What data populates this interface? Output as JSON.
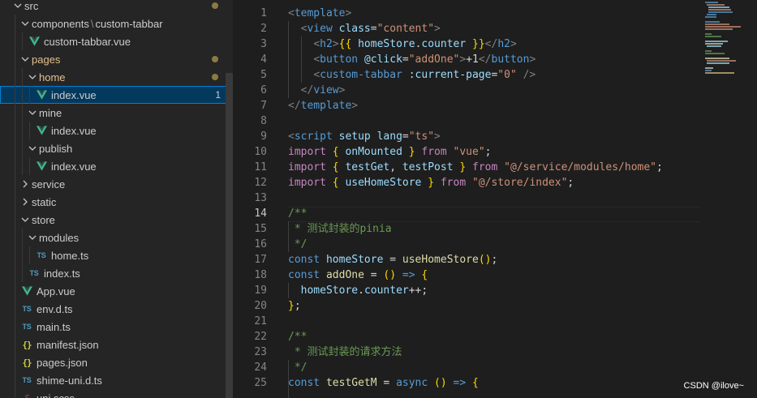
{
  "explorer": {
    "items": [
      {
        "label": "src",
        "type": "folder",
        "open": true,
        "depth": 0,
        "partial": true
      },
      {
        "label": "components",
        "label2": "custom-tabbar",
        "type": "folder",
        "open": true,
        "depth": 1
      },
      {
        "label": "custom-tabbar.vue",
        "type": "vue",
        "depth": 2
      },
      {
        "label": "pages",
        "type": "folder",
        "open": true,
        "depth": 1,
        "modified": true
      },
      {
        "label": "home",
        "type": "folder",
        "open": true,
        "depth": 2,
        "modified": true
      },
      {
        "label": "index.vue",
        "type": "vue",
        "depth": 3,
        "selected": true,
        "badge": "1"
      },
      {
        "label": "mine",
        "type": "folder",
        "open": true,
        "depth": 2
      },
      {
        "label": "index.vue",
        "type": "vue",
        "depth": 3
      },
      {
        "label": "publish",
        "type": "folder",
        "open": true,
        "depth": 2
      },
      {
        "label": "index.vue",
        "type": "vue",
        "depth": 3
      },
      {
        "label": "service",
        "type": "folder",
        "open": false,
        "depth": 1
      },
      {
        "label": "static",
        "type": "folder",
        "open": false,
        "depth": 1
      },
      {
        "label": "store",
        "type": "folder",
        "open": true,
        "depth": 1
      },
      {
        "label": "modules",
        "type": "folder",
        "open": true,
        "depth": 2
      },
      {
        "label": "home.ts",
        "type": "ts",
        "depth": 3
      },
      {
        "label": "index.ts",
        "type": "ts",
        "depth": 2
      },
      {
        "label": "App.vue",
        "type": "vue",
        "depth": 1
      },
      {
        "label": "env.d.ts",
        "type": "ts",
        "depth": 1
      },
      {
        "label": "main.ts",
        "type": "ts",
        "depth": 1
      },
      {
        "label": "manifest.json",
        "type": "json",
        "depth": 1
      },
      {
        "label": "pages.json",
        "type": "json",
        "depth": 1
      },
      {
        "label": "shime-uni.d.ts",
        "type": "ts",
        "depth": 1
      },
      {
        "label": "uni.scss",
        "type": "css",
        "depth": 1
      }
    ]
  },
  "editor": {
    "active_line": 14,
    "lines": [
      {
        "n": 1,
        "tokens": [
          [
            "t-punc",
            "<"
          ],
          [
            "t-tag",
            "template"
          ],
          [
            "t-punc",
            ">"
          ]
        ]
      },
      {
        "n": 2,
        "tokens": [
          [
            "t-text",
            "  "
          ],
          [
            "t-punc",
            "<"
          ],
          [
            "t-tag",
            "view"
          ],
          [
            "t-text",
            " "
          ],
          [
            "t-attr",
            "class"
          ],
          [
            "t-text",
            "="
          ],
          [
            "t-str",
            "\"content\""
          ],
          [
            "t-punc",
            ">"
          ]
        ]
      },
      {
        "n": 3,
        "tokens": [
          [
            "t-text",
            "    "
          ],
          [
            "t-punc",
            "<"
          ],
          [
            "t-tag",
            "h2"
          ],
          [
            "t-punc",
            ">"
          ],
          [
            "t-brace",
            "{{"
          ],
          [
            "t-text",
            " "
          ],
          [
            "t-var",
            "homeStore"
          ],
          [
            "t-text",
            "."
          ],
          [
            "t-var",
            "counter"
          ],
          [
            "t-text",
            " "
          ],
          [
            "t-brace",
            "}}"
          ],
          [
            "t-punc",
            "</"
          ],
          [
            "t-tag",
            "h2"
          ],
          [
            "t-punc",
            ">"
          ]
        ]
      },
      {
        "n": 4,
        "tokens": [
          [
            "t-text",
            "    "
          ],
          [
            "t-punc",
            "<"
          ],
          [
            "t-tag",
            "button"
          ],
          [
            "t-text",
            " "
          ],
          [
            "t-attr",
            "@click"
          ],
          [
            "t-text",
            "="
          ],
          [
            "t-str",
            "\"addOne\""
          ],
          [
            "t-punc",
            ">"
          ],
          [
            "t-text",
            "+1"
          ],
          [
            "t-punc",
            "</"
          ],
          [
            "t-tag",
            "button"
          ],
          [
            "t-punc",
            ">"
          ]
        ]
      },
      {
        "n": 5,
        "tokens": [
          [
            "t-text",
            "    "
          ],
          [
            "t-punc",
            "<"
          ],
          [
            "t-tag",
            "custom-tabbar"
          ],
          [
            "t-text",
            " "
          ],
          [
            "t-attr",
            ":current-page"
          ],
          [
            "t-text",
            "="
          ],
          [
            "t-str",
            "\"0\""
          ],
          [
            "t-text",
            " "
          ],
          [
            "t-punc",
            "/>"
          ]
        ]
      },
      {
        "n": 6,
        "tokens": [
          [
            "t-text",
            "  "
          ],
          [
            "t-punc",
            "</"
          ],
          [
            "t-tag",
            "view"
          ],
          [
            "t-punc",
            ">"
          ]
        ]
      },
      {
        "n": 7,
        "tokens": [
          [
            "t-punc",
            "</"
          ],
          [
            "t-tag",
            "template"
          ],
          [
            "t-punc",
            ">"
          ]
        ]
      },
      {
        "n": 8,
        "tokens": []
      },
      {
        "n": 9,
        "tokens": [
          [
            "t-punc",
            "<"
          ],
          [
            "t-tag",
            "script"
          ],
          [
            "t-text",
            " "
          ],
          [
            "t-attr",
            "setup"
          ],
          [
            "t-text",
            " "
          ],
          [
            "t-attr",
            "lang"
          ],
          [
            "t-text",
            "="
          ],
          [
            "t-str",
            "\"ts\""
          ],
          [
            "t-punc",
            ">"
          ]
        ]
      },
      {
        "n": 10,
        "tokens": [
          [
            "t-imp",
            "import"
          ],
          [
            "t-text",
            " "
          ],
          [
            "t-brace",
            "{"
          ],
          [
            "t-text",
            " "
          ],
          [
            "t-var",
            "onMounted"
          ],
          [
            "t-text",
            " "
          ],
          [
            "t-brace",
            "}"
          ],
          [
            "t-text",
            " "
          ],
          [
            "t-imp",
            "from"
          ],
          [
            "t-text",
            " "
          ],
          [
            "t-str",
            "\"vue\""
          ],
          [
            "t-text",
            ";"
          ]
        ]
      },
      {
        "n": 11,
        "tokens": [
          [
            "t-imp",
            "import"
          ],
          [
            "t-text",
            " "
          ],
          [
            "t-brace",
            "{"
          ],
          [
            "t-text",
            " "
          ],
          [
            "t-var",
            "testGet"
          ],
          [
            "t-text",
            ", "
          ],
          [
            "t-var",
            "testPost"
          ],
          [
            "t-text",
            " "
          ],
          [
            "t-brace",
            "}"
          ],
          [
            "t-text",
            " "
          ],
          [
            "t-imp",
            "from"
          ],
          [
            "t-text",
            " "
          ],
          [
            "t-str",
            "\"@/service/modules/home\""
          ],
          [
            "t-text",
            ";"
          ]
        ]
      },
      {
        "n": 12,
        "tokens": [
          [
            "t-imp",
            "import"
          ],
          [
            "t-text",
            " "
          ],
          [
            "t-brace",
            "{"
          ],
          [
            "t-text",
            " "
          ],
          [
            "t-var",
            "useHomeStore"
          ],
          [
            "t-text",
            " "
          ],
          [
            "t-brace",
            "}"
          ],
          [
            "t-text",
            " "
          ],
          [
            "t-imp",
            "from"
          ],
          [
            "t-text",
            " "
          ],
          [
            "t-str",
            "\"@/store/index\""
          ],
          [
            "t-text",
            ";"
          ]
        ]
      },
      {
        "n": 13,
        "tokens": []
      },
      {
        "n": 14,
        "tokens": [
          [
            "t-com",
            "/**"
          ]
        ]
      },
      {
        "n": 15,
        "tokens": [
          [
            "t-com",
            " * 测试封装的pinia"
          ]
        ]
      },
      {
        "n": 16,
        "tokens": [
          [
            "t-com",
            " */"
          ]
        ]
      },
      {
        "n": 17,
        "tokens": [
          [
            "t-kw",
            "const"
          ],
          [
            "t-text",
            " "
          ],
          [
            "t-var",
            "homeStore"
          ],
          [
            "t-text",
            " = "
          ],
          [
            "t-fn",
            "useHomeStore"
          ],
          [
            "t-brace",
            "()"
          ],
          [
            "t-text",
            ";"
          ]
        ]
      },
      {
        "n": 18,
        "tokens": [
          [
            "t-kw",
            "const"
          ],
          [
            "t-text",
            " "
          ],
          [
            "t-fn",
            "addOne"
          ],
          [
            "t-text",
            " = "
          ],
          [
            "t-brace",
            "()"
          ],
          [
            "t-text",
            " "
          ],
          [
            "t-kw",
            "=>"
          ],
          [
            "t-text",
            " "
          ],
          [
            "t-brace",
            "{"
          ]
        ]
      },
      {
        "n": 19,
        "tokens": [
          [
            "t-text",
            "  "
          ],
          [
            "t-var",
            "homeStore"
          ],
          [
            "t-text",
            "."
          ],
          [
            "t-var",
            "counter"
          ],
          [
            "t-text",
            "++;"
          ]
        ]
      },
      {
        "n": 20,
        "tokens": [
          [
            "t-brace",
            "}"
          ],
          [
            "t-text",
            ";"
          ]
        ]
      },
      {
        "n": 21,
        "tokens": []
      },
      {
        "n": 22,
        "tokens": [
          [
            "t-com",
            "/**"
          ]
        ]
      },
      {
        "n": 23,
        "tokens": [
          [
            "t-com",
            " * 测试封装的请求方法"
          ]
        ]
      },
      {
        "n": 24,
        "tokens": [
          [
            "t-com",
            " */"
          ]
        ]
      },
      {
        "n": 25,
        "tokens": [
          [
            "t-kw",
            "const"
          ],
          [
            "t-text",
            " "
          ],
          [
            "t-fn",
            "testGetM"
          ],
          [
            "t-text",
            " = "
          ],
          [
            "t-kw",
            "async"
          ],
          [
            "t-text",
            " "
          ],
          [
            "t-brace",
            "()"
          ],
          [
            "t-text",
            " "
          ],
          [
            "t-kw",
            "=>"
          ],
          [
            "t-text",
            " "
          ],
          [
            "t-brace",
            "{"
          ]
        ]
      }
    ]
  },
  "watermark": "CSDN @ilove~",
  "colors": {
    "sidebar_bg": "#252526",
    "editor_bg": "#1e1e1e",
    "selection_bg": "#04395e",
    "vue_green": "#41b883",
    "ts_blue": "#519aba",
    "modified": "#e2c08d"
  }
}
